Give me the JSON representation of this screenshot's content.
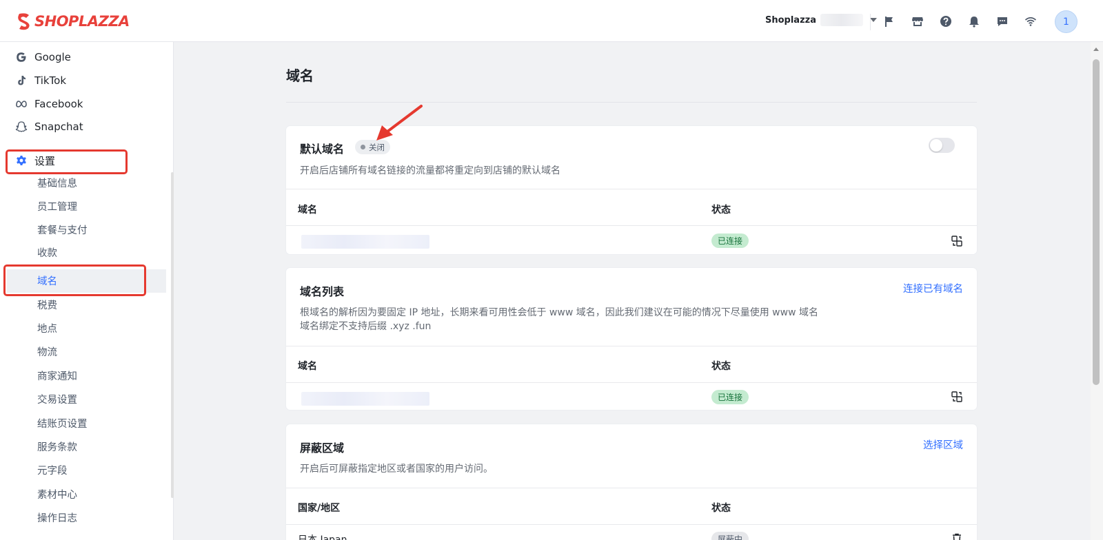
{
  "brand": {
    "name": "SHOPLAZZA",
    "color": "#e8413b"
  },
  "header": {
    "store_name": "Shoplazza",
    "avatar_label": "1",
    "icons": [
      "flag-icon",
      "store-icon",
      "help-icon",
      "bell-icon",
      "message-icon",
      "wifi-icon"
    ]
  },
  "sidebar": {
    "channels": [
      {
        "label": "Google",
        "icon": "google-icon"
      },
      {
        "label": "TikTok",
        "icon": "tiktok-icon"
      },
      {
        "label": "Facebook",
        "icon": "meta-icon"
      },
      {
        "label": "Snapchat",
        "icon": "snapchat-icon"
      }
    ],
    "settings_label": "设置",
    "settings_items": [
      "基础信息",
      "员工管理",
      "套餐与支付",
      "收款",
      "域名",
      "税费",
      "地点",
      "物流",
      "商家通知",
      "交易设置",
      "结账页设置",
      "服务条款",
      "元字段",
      "素材中心",
      "操作日志"
    ],
    "active_item": "域名"
  },
  "main": {
    "title": "域名",
    "default_domain": {
      "title": "默认域名",
      "status": "关闭",
      "enabled": false,
      "description": "开启后店铺所有域名链接的流量都将重定向到店铺的默认域名",
      "col_domain": "域名",
      "col_status": "状态",
      "row_status": "已连接"
    },
    "domain_list": {
      "title": "域名列表",
      "link": "连接已有域名",
      "description_1": "根域名的解析因为要固定 IP 地址，长期来看可用性会低于 www 域名，因此我们建议在可能的情况下尽量使用 www 域名",
      "description_2": "域名绑定不支持后缀 .xyz .fun",
      "col_domain": "域名",
      "col_status": "状态",
      "row_status": "已连接"
    },
    "blocked_regions": {
      "title": "屏蔽区域",
      "link": "选择区域",
      "description": "开启后可屏蔽指定地区或者国家的用户访问。",
      "col_region": "国家/地区",
      "col_status": "状态",
      "row_region": "日本 Japan",
      "row_status": "屏蔽中"
    }
  },
  "colors": {
    "accent": "#3370ff",
    "highlight": "#e5392f",
    "connected": "#c4ebd0"
  }
}
